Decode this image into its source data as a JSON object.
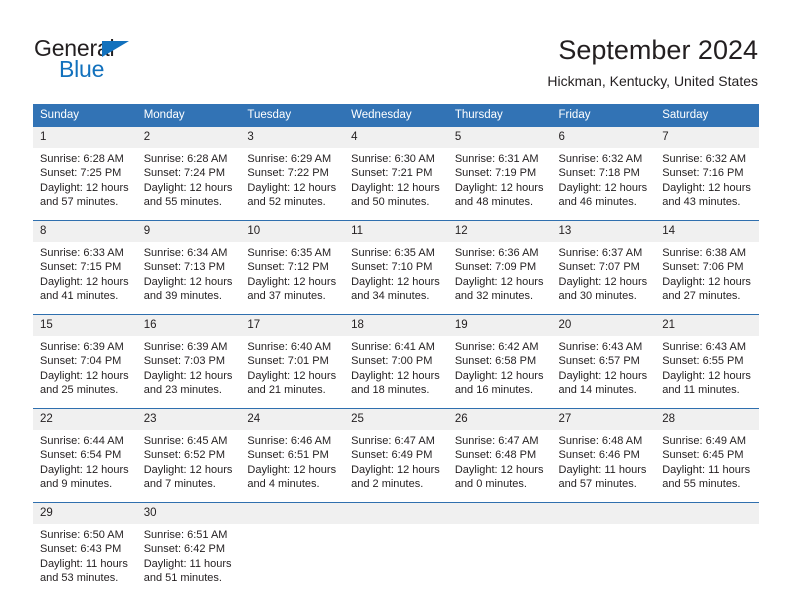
{
  "brand": {
    "name_top": "General",
    "name_bottom": "Blue",
    "triangle_color": "#1271bd"
  },
  "header": {
    "title": "September 2024",
    "subtitle": "Hickman, Kentucky, United States"
  },
  "theme": {
    "header_blue": "#3273b5",
    "separator_blue": "#2f6fae",
    "daynum_gray": "#f0f0f0"
  },
  "calendar": {
    "weekday_headers": [
      "Sunday",
      "Monday",
      "Tuesday",
      "Wednesday",
      "Thursday",
      "Friday",
      "Saturday"
    ],
    "weeks": [
      [
        {
          "day": "1",
          "sunrise": "Sunrise: 6:28 AM",
          "sunset": "Sunset: 7:25 PM",
          "daylight1": "Daylight: 12 hours",
          "daylight2": "and 57 minutes."
        },
        {
          "day": "2",
          "sunrise": "Sunrise: 6:28 AM",
          "sunset": "Sunset: 7:24 PM",
          "daylight1": "Daylight: 12 hours",
          "daylight2": "and 55 minutes."
        },
        {
          "day": "3",
          "sunrise": "Sunrise: 6:29 AM",
          "sunset": "Sunset: 7:22 PM",
          "daylight1": "Daylight: 12 hours",
          "daylight2": "and 52 minutes."
        },
        {
          "day": "4",
          "sunrise": "Sunrise: 6:30 AM",
          "sunset": "Sunset: 7:21 PM",
          "daylight1": "Daylight: 12 hours",
          "daylight2": "and 50 minutes."
        },
        {
          "day": "5",
          "sunrise": "Sunrise: 6:31 AM",
          "sunset": "Sunset: 7:19 PM",
          "daylight1": "Daylight: 12 hours",
          "daylight2": "and 48 minutes."
        },
        {
          "day": "6",
          "sunrise": "Sunrise: 6:32 AM",
          "sunset": "Sunset: 7:18 PM",
          "daylight1": "Daylight: 12 hours",
          "daylight2": "and 46 minutes."
        },
        {
          "day": "7",
          "sunrise": "Sunrise: 6:32 AM",
          "sunset": "Sunset: 7:16 PM",
          "daylight1": "Daylight: 12 hours",
          "daylight2": "and 43 minutes."
        }
      ],
      [
        {
          "day": "8",
          "sunrise": "Sunrise: 6:33 AM",
          "sunset": "Sunset: 7:15 PM",
          "daylight1": "Daylight: 12 hours",
          "daylight2": "and 41 minutes."
        },
        {
          "day": "9",
          "sunrise": "Sunrise: 6:34 AM",
          "sunset": "Sunset: 7:13 PM",
          "daylight1": "Daylight: 12 hours",
          "daylight2": "and 39 minutes."
        },
        {
          "day": "10",
          "sunrise": "Sunrise: 6:35 AM",
          "sunset": "Sunset: 7:12 PM",
          "daylight1": "Daylight: 12 hours",
          "daylight2": "and 37 minutes."
        },
        {
          "day": "11",
          "sunrise": "Sunrise: 6:35 AM",
          "sunset": "Sunset: 7:10 PM",
          "daylight1": "Daylight: 12 hours",
          "daylight2": "and 34 minutes."
        },
        {
          "day": "12",
          "sunrise": "Sunrise: 6:36 AM",
          "sunset": "Sunset: 7:09 PM",
          "daylight1": "Daylight: 12 hours",
          "daylight2": "and 32 minutes."
        },
        {
          "day": "13",
          "sunrise": "Sunrise: 6:37 AM",
          "sunset": "Sunset: 7:07 PM",
          "daylight1": "Daylight: 12 hours",
          "daylight2": "and 30 minutes."
        },
        {
          "day": "14",
          "sunrise": "Sunrise: 6:38 AM",
          "sunset": "Sunset: 7:06 PM",
          "daylight1": "Daylight: 12 hours",
          "daylight2": "and 27 minutes."
        }
      ],
      [
        {
          "day": "15",
          "sunrise": "Sunrise: 6:39 AM",
          "sunset": "Sunset: 7:04 PM",
          "daylight1": "Daylight: 12 hours",
          "daylight2": "and 25 minutes."
        },
        {
          "day": "16",
          "sunrise": "Sunrise: 6:39 AM",
          "sunset": "Sunset: 7:03 PM",
          "daylight1": "Daylight: 12 hours",
          "daylight2": "and 23 minutes."
        },
        {
          "day": "17",
          "sunrise": "Sunrise: 6:40 AM",
          "sunset": "Sunset: 7:01 PM",
          "daylight1": "Daylight: 12 hours",
          "daylight2": "and 21 minutes."
        },
        {
          "day": "18",
          "sunrise": "Sunrise: 6:41 AM",
          "sunset": "Sunset: 7:00 PM",
          "daylight1": "Daylight: 12 hours",
          "daylight2": "and 18 minutes."
        },
        {
          "day": "19",
          "sunrise": "Sunrise: 6:42 AM",
          "sunset": "Sunset: 6:58 PM",
          "daylight1": "Daylight: 12 hours",
          "daylight2": "and 16 minutes."
        },
        {
          "day": "20",
          "sunrise": "Sunrise: 6:43 AM",
          "sunset": "Sunset: 6:57 PM",
          "daylight1": "Daylight: 12 hours",
          "daylight2": "and 14 minutes."
        },
        {
          "day": "21",
          "sunrise": "Sunrise: 6:43 AM",
          "sunset": "Sunset: 6:55 PM",
          "daylight1": "Daylight: 12 hours",
          "daylight2": "and 11 minutes."
        }
      ],
      [
        {
          "day": "22",
          "sunrise": "Sunrise: 6:44 AM",
          "sunset": "Sunset: 6:54 PM",
          "daylight1": "Daylight: 12 hours",
          "daylight2": "and 9 minutes."
        },
        {
          "day": "23",
          "sunrise": "Sunrise: 6:45 AM",
          "sunset": "Sunset: 6:52 PM",
          "daylight1": "Daylight: 12 hours",
          "daylight2": "and 7 minutes."
        },
        {
          "day": "24",
          "sunrise": "Sunrise: 6:46 AM",
          "sunset": "Sunset: 6:51 PM",
          "daylight1": "Daylight: 12 hours",
          "daylight2": "and 4 minutes."
        },
        {
          "day": "25",
          "sunrise": "Sunrise: 6:47 AM",
          "sunset": "Sunset: 6:49 PM",
          "daylight1": "Daylight: 12 hours",
          "daylight2": "and 2 minutes."
        },
        {
          "day": "26",
          "sunrise": "Sunrise: 6:47 AM",
          "sunset": "Sunset: 6:48 PM",
          "daylight1": "Daylight: 12 hours",
          "daylight2": "and 0 minutes."
        },
        {
          "day": "27",
          "sunrise": "Sunrise: 6:48 AM",
          "sunset": "Sunset: 6:46 PM",
          "daylight1": "Daylight: 11 hours",
          "daylight2": "and 57 minutes."
        },
        {
          "day": "28",
          "sunrise": "Sunrise: 6:49 AM",
          "sunset": "Sunset: 6:45 PM",
          "daylight1": "Daylight: 11 hours",
          "daylight2": "and 55 minutes."
        }
      ],
      [
        {
          "day": "29",
          "sunrise": "Sunrise: 6:50 AM",
          "sunset": "Sunset: 6:43 PM",
          "daylight1": "Daylight: 11 hours",
          "daylight2": "and 53 minutes."
        },
        {
          "day": "30",
          "sunrise": "Sunrise: 6:51 AM",
          "sunset": "Sunset: 6:42 PM",
          "daylight1": "Daylight: 11 hours",
          "daylight2": "and 51 minutes."
        },
        {
          "day": "",
          "sunrise": "",
          "sunset": "",
          "daylight1": "",
          "daylight2": ""
        },
        {
          "day": "",
          "sunrise": "",
          "sunset": "",
          "daylight1": "",
          "daylight2": ""
        },
        {
          "day": "",
          "sunrise": "",
          "sunset": "",
          "daylight1": "",
          "daylight2": ""
        },
        {
          "day": "",
          "sunrise": "",
          "sunset": "",
          "daylight1": "",
          "daylight2": ""
        },
        {
          "day": "",
          "sunrise": "",
          "sunset": "",
          "daylight1": "",
          "daylight2": ""
        }
      ]
    ]
  }
}
